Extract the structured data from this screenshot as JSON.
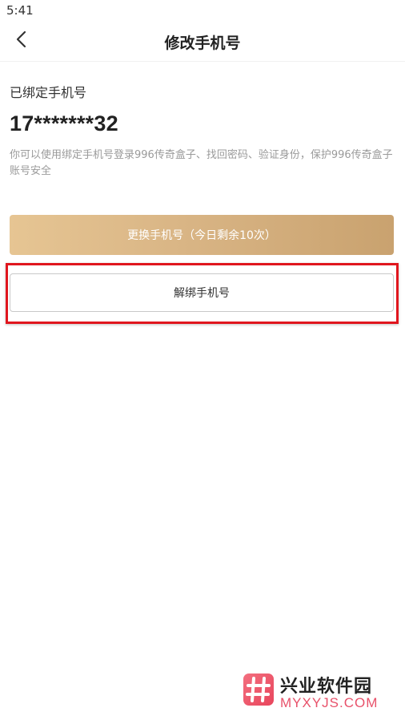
{
  "status_bar": {
    "time": "5:41"
  },
  "nav": {
    "title": "修改手机号",
    "back_icon": "chevron-left-icon"
  },
  "bound": {
    "label": "已绑定手机号",
    "phone": "17*******32",
    "description": "你可以使用绑定手机号登录996传奇盒子、找回密码、验证身份，保护996传奇盒子账号安全"
  },
  "actions": {
    "change_label": "更换手机号（今日剩余10次）",
    "unbind_label": "解绑手机号"
  },
  "colors": {
    "accent_gradient_start": "#e6c593",
    "accent_gradient_end": "#c9a26f",
    "highlight": "#e0161e"
  },
  "watermark": {
    "title": "兴业软件园",
    "url": "MYXYJS.COM",
    "logo_icon": "hash-logo-icon"
  }
}
